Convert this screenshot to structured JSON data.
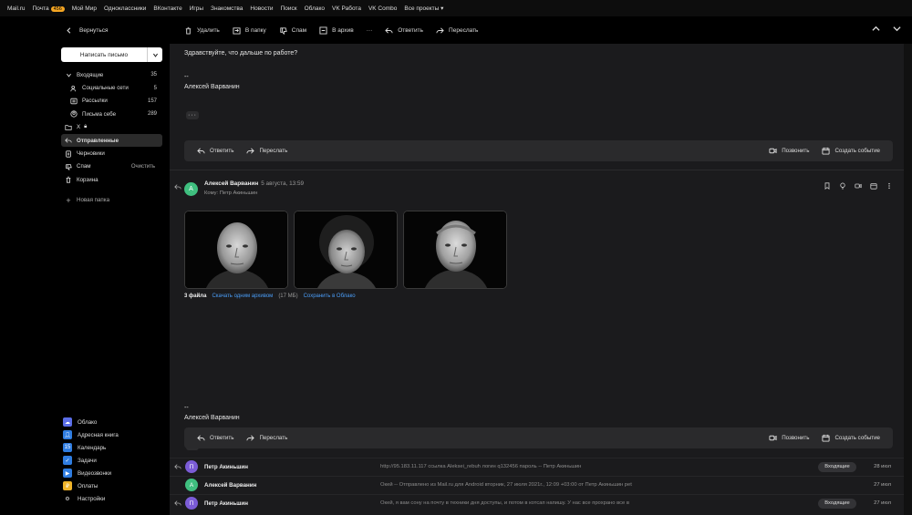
{
  "portal": {
    "items": [
      "Mail.ru",
      "Почта",
      "Мой Мир",
      "Одноклассники",
      "ВКонтакте",
      "Игры",
      "Знакомства",
      "Новости",
      "Поиск",
      "Облако",
      "VK Работа",
      "VK Combo",
      "Все проекты"
    ],
    "mail_badge": "456"
  },
  "toolbar": {
    "back": "Вернуться",
    "delete": "Удалить",
    "to_folder": "В папку",
    "spam": "Спам",
    "archive": "В архив",
    "more": "···",
    "reply": "Ответить",
    "forward": "Переслать"
  },
  "sidebar": {
    "compose": "Написать письмо",
    "folders": [
      {
        "label": "Входящие",
        "count": "35"
      },
      {
        "label": "Социальные сети",
        "count": "5"
      },
      {
        "label": "Рассылки",
        "count": "157"
      },
      {
        "label": "Письма себе",
        "count": "289"
      },
      {
        "label": "X",
        "count": ""
      },
      {
        "label": "Отправленные",
        "count": ""
      },
      {
        "label": "Черновики",
        "count": ""
      },
      {
        "label": "Спам",
        "count": "",
        "extra": "Очистить"
      },
      {
        "label": "Корзина",
        "count": ""
      }
    ],
    "new_folder": "Новая папка",
    "apps": [
      "Облако",
      "Адресная книга",
      "Календарь",
      "Задачи",
      "Видеозвонки",
      "Оплаты",
      "Настройки"
    ]
  },
  "message1": {
    "body": "Здравствуйте, что дальше по работе?",
    "sig_dash": "--",
    "signature": "Алексей Варванин",
    "more": "···",
    "reply": "Ответить",
    "forward": "Переслать",
    "call": "Позвонить",
    "event": "Создать событие"
  },
  "message2": {
    "avatar_letter": "А",
    "sender": "Алексей Варванин",
    "date": "5 августа, 13:59",
    "to": "Кому: Петр Акиньшин",
    "files_count": "3 файла",
    "download": "Скачать одним архивом",
    "size": "(17 МБ)",
    "save_cloud": "Сохранить в Облако",
    "sig_dash": "--",
    "signature": "Алексей Варванин",
    "more": "···",
    "reply": "Ответить",
    "forward": "Переслать",
    "call": "Позвонить",
    "event": "Создать событие"
  },
  "list": [
    {
      "letter": "П",
      "color": "#7b5cd6",
      "name": "Петр Акиньшин",
      "snippet": "http://95.183.11.117 ссылка Aleksei_rebuh логин q132456 пароль -- Петр Акиньшин",
      "tag": "Входящие",
      "date": "28 июл"
    },
    {
      "letter": "А",
      "color": "#3fbf7f",
      "name": "Алексей Варванин",
      "snippet": "Окей -- Отправлено из Mail.ru для Android вторник, 27 июля 2021г., 12:09 +03:00 от Петр Акиньшин pet",
      "tag": "",
      "date": "27 июл"
    },
    {
      "letter": "П",
      "color": "#7b5cd6",
      "name": "Петр Акиньшин",
      "snippet": "Окей, я вам сону на почту в техники дня доступы, и потом в котсап напишу. У нас все прохрано все в",
      "tag": "Входящие",
      "date": "27 июл"
    }
  ]
}
